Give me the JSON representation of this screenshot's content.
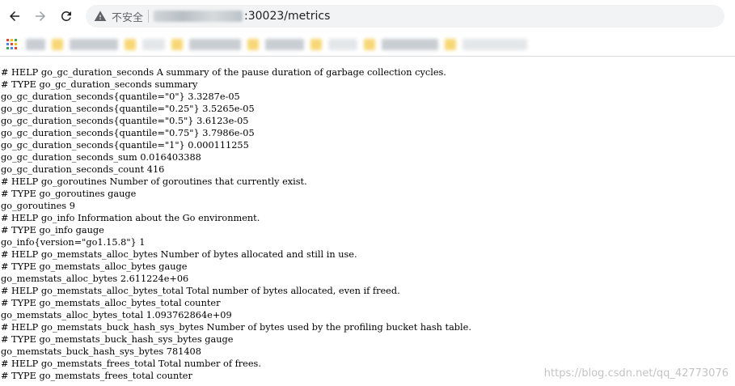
{
  "browser": {
    "insecure_label": "不安全",
    "url_suffix": ":30023/metrics",
    "colors": {
      "omnibox_bg": "#f1f3f4",
      "toolbar_icon": "#5f6368",
      "border": "#dadce0"
    },
    "icons": [
      "back-arrow-icon",
      "forward-arrow-icon",
      "reload-icon",
      "warning-triangle-icon",
      "apps-grid-icon"
    ]
  },
  "metrics_lines": [
    "# HELP go_gc_duration_seconds A summary of the pause duration of garbage collection cycles.",
    "# TYPE go_gc_duration_seconds summary",
    "go_gc_duration_seconds{quantile=\"0\"} 3.3287e-05",
    "go_gc_duration_seconds{quantile=\"0.25\"} 3.5265e-05",
    "go_gc_duration_seconds{quantile=\"0.5\"} 3.6123e-05",
    "go_gc_duration_seconds{quantile=\"0.75\"} 3.7986e-05",
    "go_gc_duration_seconds{quantile=\"1\"} 0.000111255",
    "go_gc_duration_seconds_sum 0.016403388",
    "go_gc_duration_seconds_count 416",
    "# HELP go_goroutines Number of goroutines that currently exist.",
    "# TYPE go_goroutines gauge",
    "go_goroutines 9",
    "# HELP go_info Information about the Go environment.",
    "# TYPE go_info gauge",
    "go_info{version=\"go1.15.8\"} 1",
    "# HELP go_memstats_alloc_bytes Number of bytes allocated and still in use.",
    "# TYPE go_memstats_alloc_bytes gauge",
    "go_memstats_alloc_bytes 2.611224e+06",
    "# HELP go_memstats_alloc_bytes_total Total number of bytes allocated, even if freed.",
    "# TYPE go_memstats_alloc_bytes_total counter",
    "go_memstats_alloc_bytes_total 1.093762864e+09",
    "# HELP go_memstats_buck_hash_sys_bytes Number of bytes used by the profiling bucket hash table.",
    "# TYPE go_memstats_buck_hash_sys_bytes gauge",
    "go_memstats_buck_hash_sys_bytes 781408",
    "# HELP go_memstats_frees_total Total number of frees.",
    "# TYPE go_memstats_frees_total counter"
  ],
  "watermark": "https://blog.csdn.net/qq_42773076"
}
